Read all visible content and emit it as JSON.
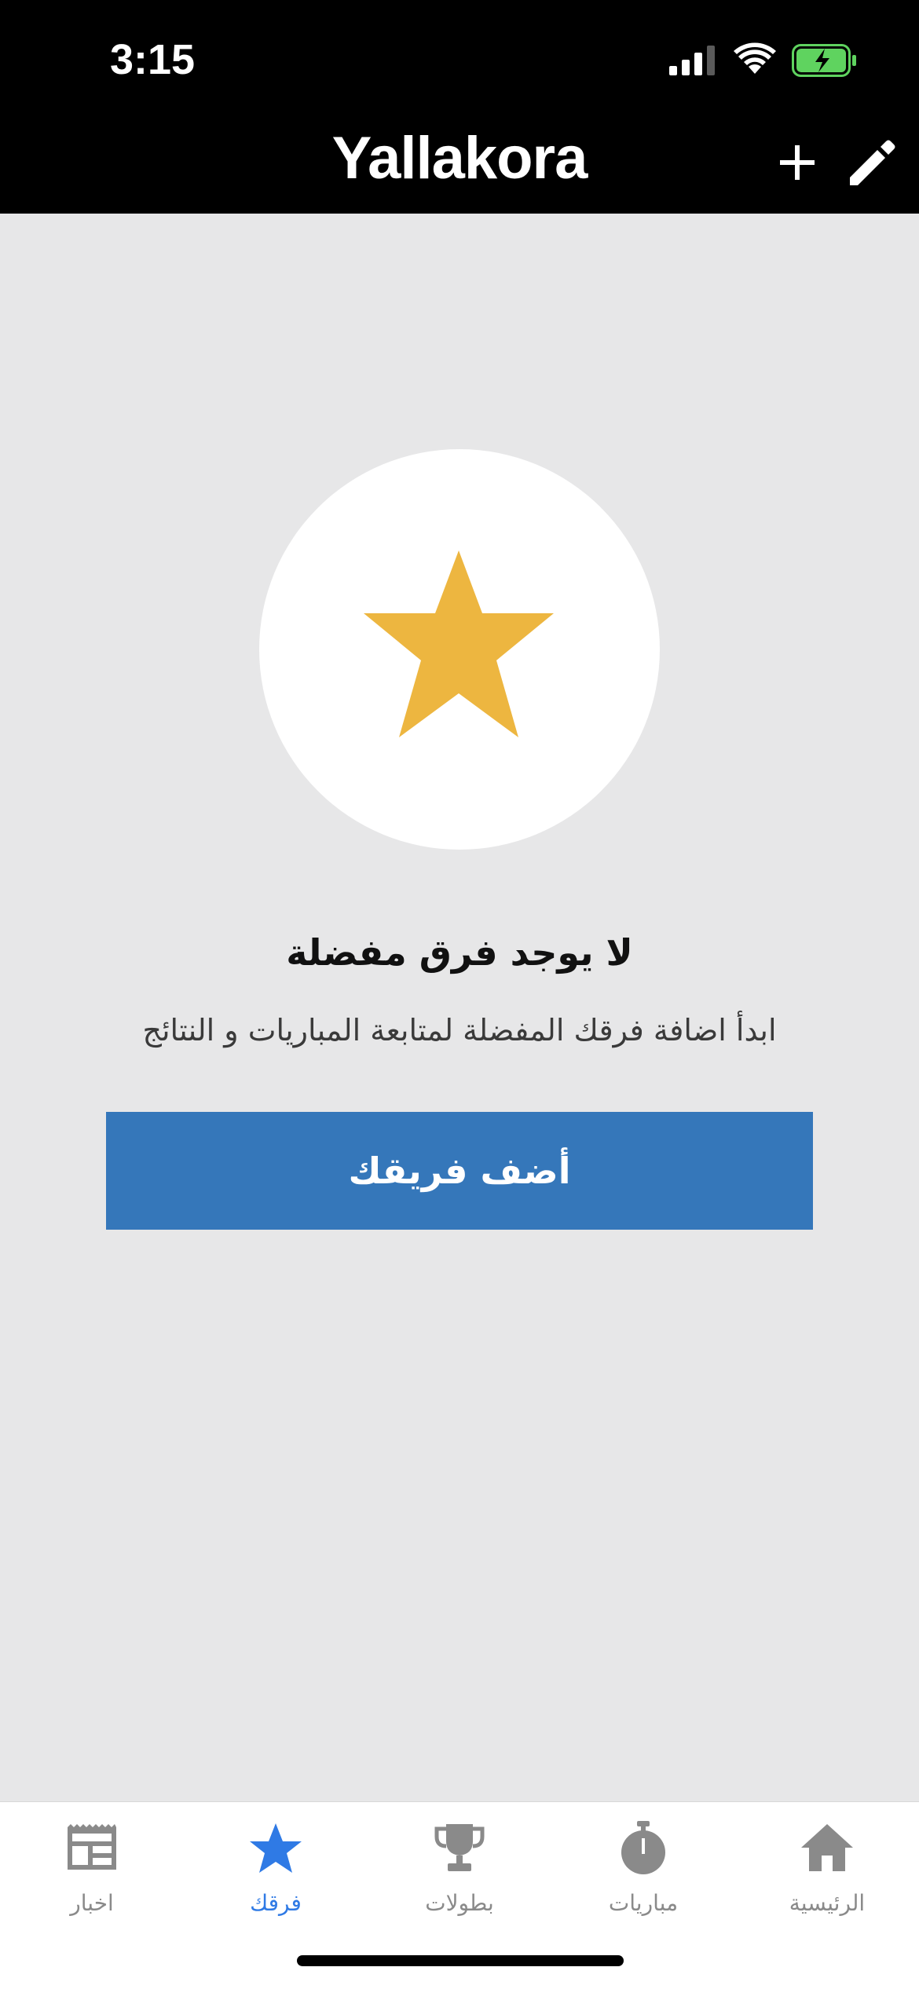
{
  "status_bar": {
    "time": "3:15"
  },
  "header": {
    "logo": "Yallakora"
  },
  "empty_state": {
    "title": "لا يوجد فرق مفضلة",
    "subtitle": "ابدأ اضافة فرقك المفضلة لمتابعة المباريات و النتائج",
    "button_label": "أضف فريقك"
  },
  "tabs": [
    {
      "label": "اخبار",
      "icon": "news-icon",
      "active": false
    },
    {
      "label": "فرقك",
      "icon": "star-icon",
      "active": true
    },
    {
      "label": "بطولات",
      "icon": "trophy-icon",
      "active": false
    },
    {
      "label": "مباريات",
      "icon": "stopwatch-icon",
      "active": false
    },
    {
      "label": "الرئيسية",
      "icon": "home-icon",
      "active": false
    }
  ],
  "colors": {
    "accent_blue": "#3577ba",
    "active_tab": "#2f7ae5",
    "star": "#edb640",
    "background": "#e7e7e8",
    "header": "#000000"
  }
}
